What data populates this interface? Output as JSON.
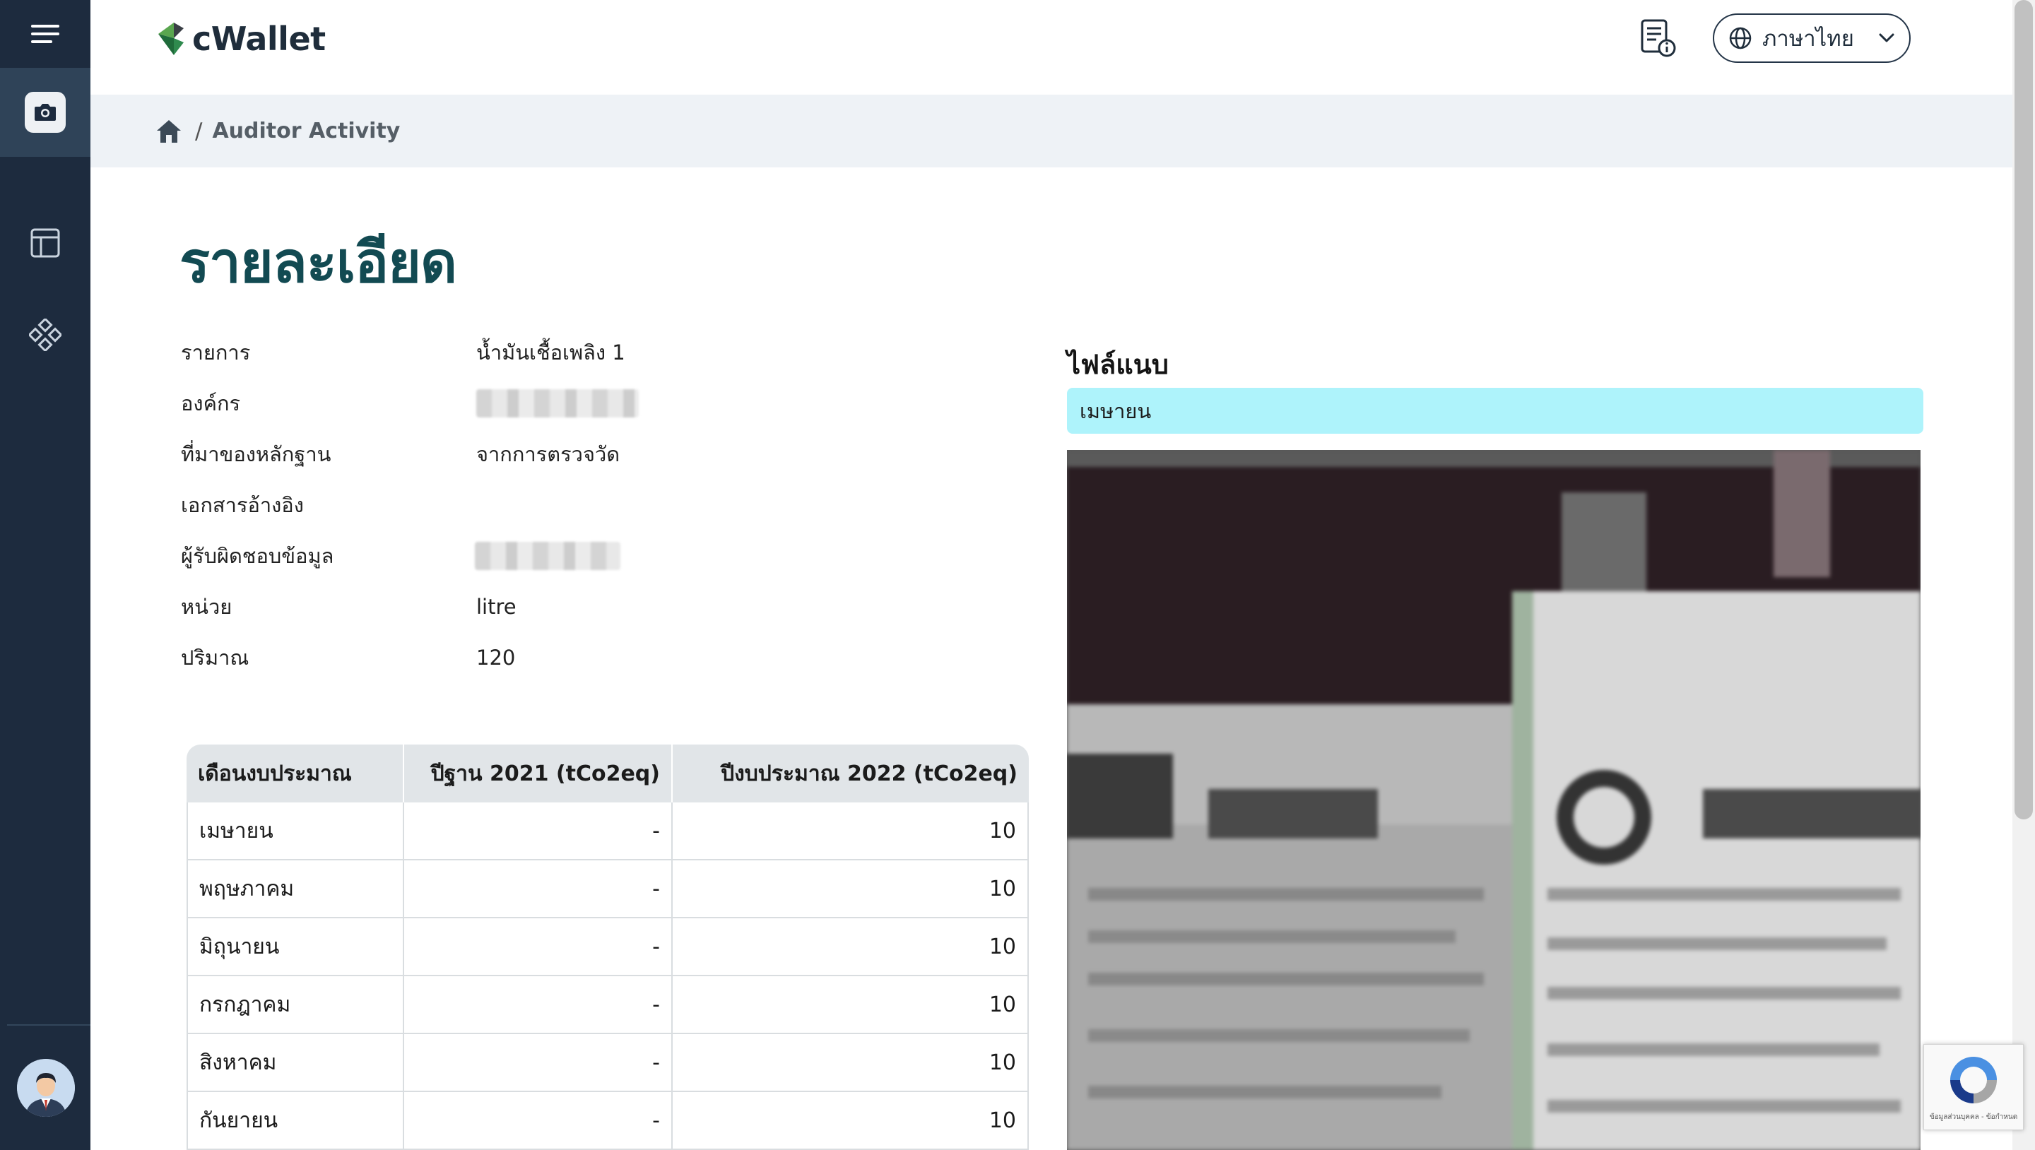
{
  "app": {
    "brand": "cWallet"
  },
  "header": {
    "language_label": "ภาษาไทย"
  },
  "breadcrumb": {
    "separator": "/",
    "current": "Auditor Activity"
  },
  "page": {
    "title": "รายละเอียด"
  },
  "details": [
    {
      "label": "รายการ",
      "value": "น้ำมันเชื้อเพลิง 1"
    },
    {
      "label": "องค์กร",
      "value": ""
    },
    {
      "label": "ที่มาของหลักฐาน",
      "value": "จากการตรวจวัด"
    },
    {
      "label": "เอกสารอ้างอิง",
      "value": ""
    },
    {
      "label": "ผู้รับผิดชอบข้อมูล",
      "value": ""
    },
    {
      "label": "หน่วย",
      "value": "litre"
    },
    {
      "label": "ปริมาณ",
      "value": "120"
    }
  ],
  "table": {
    "headers": [
      "เดือนงบประมาณ",
      "ปีฐาน 2021 (tCo2eq)",
      "ปีงบประมาณ 2022 (tCo2eq)"
    ],
    "rows": [
      [
        "เมษายน",
        "-",
        "10"
      ],
      [
        "พฤษภาคม",
        "-",
        "10"
      ],
      [
        "มิถุนายน",
        "-",
        "10"
      ],
      [
        "กรกฎาคม",
        "-",
        "10"
      ],
      [
        "สิงหาคม",
        "-",
        "10"
      ],
      [
        "กันยายน",
        "-",
        "10"
      ]
    ]
  },
  "attachments": {
    "title": "ไฟล์แนบ",
    "selected_month": "เมษายน"
  },
  "captcha": {
    "text": "ข้อมูลส่วนบุคคล - ข้อกำหนด"
  },
  "icons": {
    "menu": "hamburger-menu-icon",
    "camera": "camera-icon",
    "layout": "layout-icon",
    "components": "components-icon",
    "document": "document-info-icon",
    "globe": "globe-icon",
    "chevron": "chevron-down-icon",
    "home": "home-icon"
  },
  "colors": {
    "sidebar": "#1d2b3e",
    "sidebar_active": "#2f4358",
    "title": "#124a52",
    "month_bar": "#aef3fb",
    "crumb_bar": "#eef2f6",
    "logo_green": "#2f8a4e"
  }
}
